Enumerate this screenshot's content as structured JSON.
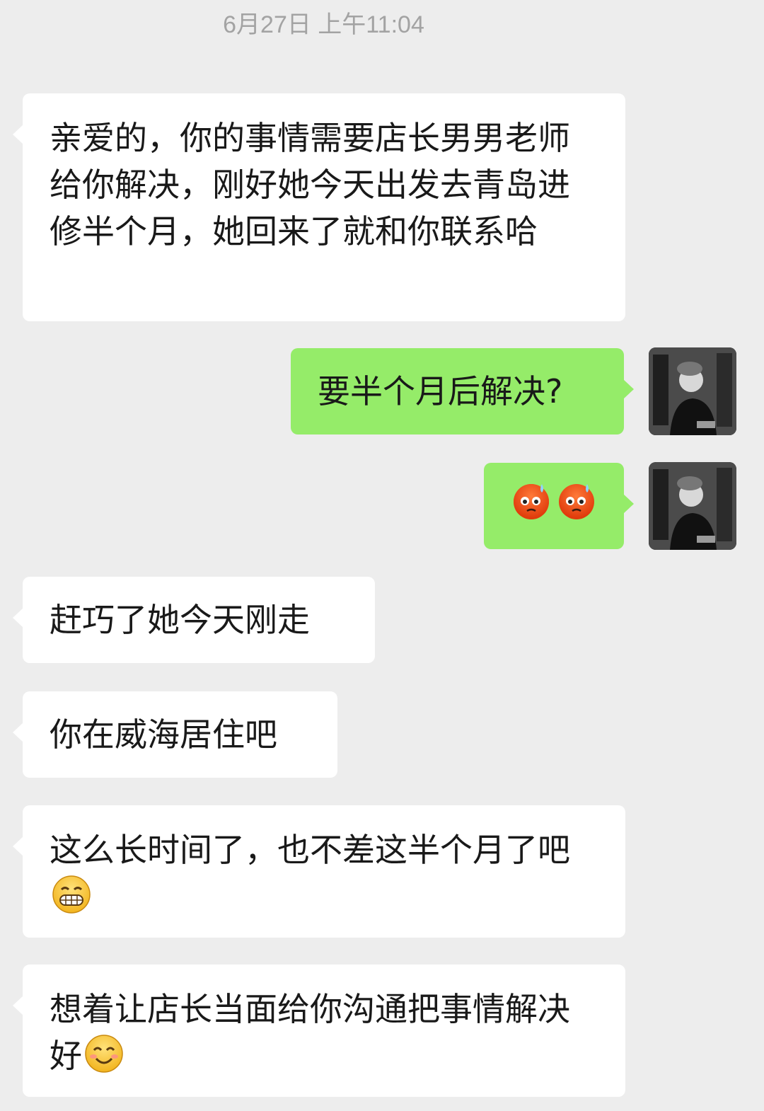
{
  "timestamp": "6月27日 上午11:04",
  "messages": [
    {
      "side": "left",
      "text": "亲爱的，你的事情需要店长男男老师给你解决，刚好她今天出发去青岛进修半个月，她回来了就和你联系哈"
    },
    {
      "side": "right",
      "text": "要半个月后解决?"
    },
    {
      "side": "right",
      "emojis": [
        "sweat-anxious-emoji",
        "sweat-anxious-emoji"
      ]
    },
    {
      "side": "left",
      "text": "赶巧了她今天刚走"
    },
    {
      "side": "left",
      "text": "你在威海居住吧"
    },
    {
      "side": "left",
      "text": "这么长时间了，也不差这半个月了吧",
      "emoji": "grin-emoji"
    },
    {
      "side": "left",
      "text": "想着让店长当面给你沟通把事情解决好",
      "emoji": "smile-emoji"
    }
  ],
  "colors": {
    "background": "#ededed",
    "incoming_bubble": "#ffffff",
    "outgoing_bubble": "#95ec69",
    "timestamp_text": "#a3a3a3"
  },
  "icons": {
    "avatar": "user-avatar-photo",
    "emoji_sweat": "sweat-anxious-emoji",
    "emoji_grin": "grin-emoji",
    "emoji_smile": "smile-emoji"
  }
}
